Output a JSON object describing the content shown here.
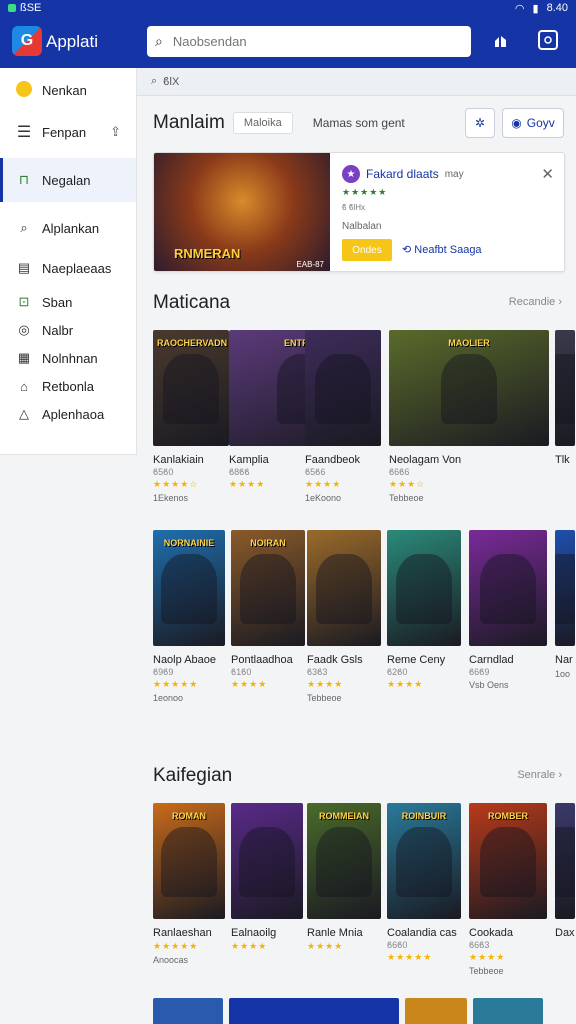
{
  "status": {
    "left": "ßSE",
    "right": "8.40"
  },
  "app": {
    "title": "Applati",
    "logo_letter": "G"
  },
  "search": {
    "placeholder": "Naobsendan"
  },
  "sidebar": {
    "items": [
      {
        "label": "Nenkan",
        "icon": "badge-icon"
      },
      {
        "label": "Fenpan",
        "icon": "menu-icon"
      },
      {
        "label": "Negalan",
        "icon": "bag-icon"
      },
      {
        "label": "Alplankan",
        "icon": "search-icon"
      },
      {
        "label": "Naeplaeaas",
        "icon": "list-icon"
      },
      {
        "label": "Sban",
        "icon": "shop-icon"
      },
      {
        "label": "Nalbr",
        "icon": "circle-icon"
      },
      {
        "label": "Nolnhnan",
        "icon": "grid-icon"
      },
      {
        "label": "Retbonla",
        "icon": "home-icon"
      },
      {
        "label": "Aplenhaoa",
        "icon": "cloud-icon"
      }
    ]
  },
  "subbar": {
    "text": "ϐlX"
  },
  "header": {
    "title": "Manlaim",
    "chip": "Maloika",
    "subtitle": "Mamas som gent",
    "action_label": "Goyv"
  },
  "feature": {
    "art_title": "RNMERAN",
    "art_badge": "EAB-87",
    "app_name": "Fakard dlaats",
    "app_suffix": "may",
    "stars": "★★★★★",
    "small": "ϐ ϐlHx",
    "developer": "Nalbalan",
    "install_label": "Ondes",
    "link_label": "Neafbt Saaga"
  },
  "sections": [
    {
      "title": "Maticana",
      "more": "Recandie"
    },
    {
      "title": "Kaifegian",
      "more": "Senrale"
    }
  ],
  "row1": [
    {
      "name": "Kanlakiain",
      "sub": "ϐ5ϐ0",
      "stars": "★★★★☆",
      "count": "1Ekenos",
      "label": "RAOCHERVADN",
      "color": "#4a3a2e"
    },
    {
      "name": "Kamplia",
      "sub": "ϐ8ϐϐ",
      "stars": "★★★★",
      "count": "",
      "label": "ENTRAIEI",
      "color": "#5b3a7a"
    },
    {
      "name": "Faandbeok",
      "sub": "ϐ5ϐ6",
      "stars": "★★★★",
      "count": "1eKoono",
      "label": "",
      "color": "#3d2c5a"
    },
    {
      "name": "Neolagam Von",
      "sub": "ϐ6ϐ6",
      "stars": "★★★☆",
      "count": "Tebbeoe",
      "label": "MAOLIER",
      "color": "#5a6b2a"
    },
    {
      "name": "Tlk",
      "sub": "",
      "stars": "",
      "count": "",
      "label": "",
      "color": "#3a3a4a"
    }
  ],
  "row2": [
    {
      "name": "Naolp Abaoe",
      "sub": "ϐ9ϐ9",
      "stars": "★★★★★",
      "count": "1eonoo",
      "label": "NORNAINIE",
      "color": "#1f6fae"
    },
    {
      "name": "Pontlaadhoa",
      "sub": "ϐ1ϐ0",
      "stars": "★★★★",
      "count": "",
      "label": "NOIRAN",
      "color": "#8a5a2a"
    },
    {
      "name": "Faadk Gsls",
      "sub": "ϐ3ϐ3",
      "stars": "★★★★",
      "count": "Tebbeoe",
      "label": "",
      "color": "#9a6a2a"
    },
    {
      "name": "Reme Ceny",
      "sub": "ϐ2ϐ0",
      "stars": "★★★★",
      "count": "",
      "label": "",
      "color": "#2a8a7a"
    },
    {
      "name": "Carndlad",
      "sub": "ϐ6ϐ9",
      "stars": "",
      "count": "Vsb Oens",
      "label": "",
      "color": "#7a2a9a"
    },
    {
      "name": "Nar",
      "sub": "",
      "stars": "",
      "count": "1oo",
      "label": "",
      "color": "#1f4fae"
    }
  ],
  "row3": [
    {
      "name": "Ranlaeshan",
      "sub": "",
      "stars": "★★★★★",
      "count": "Anoocas",
      "label": "ROMAN",
      "color": "#c96b1a"
    },
    {
      "name": "Ealnaoilg",
      "sub": "",
      "stars": "★★★★",
      "count": "",
      "label": "",
      "color": "#5a2a8a"
    },
    {
      "name": "Ranle Mnia",
      "sub": "",
      "stars": "★★★★",
      "count": "",
      "label": "ROMMEIAN",
      "color": "#4a6a2a"
    },
    {
      "name": "Coalandia cas",
      "sub": "ϐ6ϐ0",
      "stars": "★★★★★",
      "count": "",
      "label": "ROINBUIR",
      "color": "#2a7a9a"
    },
    {
      "name": "Cookada",
      "sub": "ϐ6ϐ3",
      "stars": "★★★★",
      "count": "Tebbeoe",
      "label": "ROMBER",
      "color": "#b83a1a"
    },
    {
      "name": "Dax",
      "sub": "",
      "stars": "",
      "count": "",
      "label": "",
      "color": "#3a3a6a"
    }
  ]
}
